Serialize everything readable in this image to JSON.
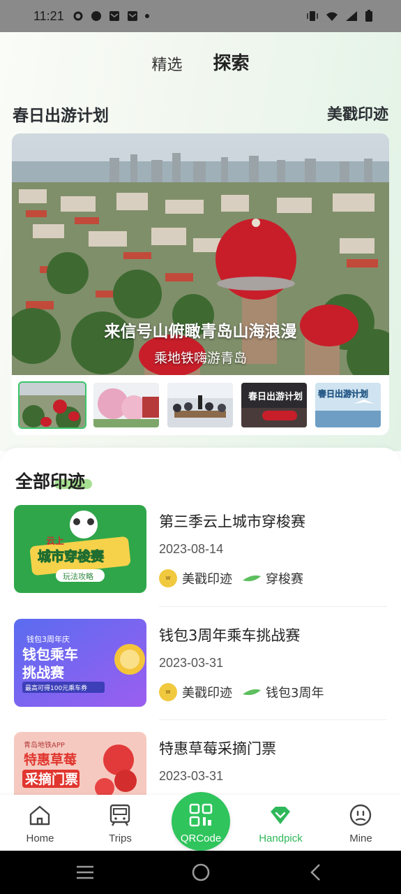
{
  "status_bar": {
    "time": "11:21"
  },
  "tabs": [
    {
      "label": "精选",
      "active": false
    },
    {
      "label": "探索",
      "active": true
    }
  ],
  "spring_section": {
    "title": "春日出游计划",
    "link": "美戳印迹"
  },
  "hero": {
    "title": "来信号山俯瞰青岛山海浪漫",
    "subtitle": "乘地铁嗨游青岛"
  },
  "thumbnails": [
    {
      "caption": "",
      "selected": true
    },
    {
      "caption": "",
      "selected": false
    },
    {
      "caption": "",
      "selected": false
    },
    {
      "caption": "春日出游计划",
      "selected": false
    },
    {
      "caption": "春日出游计划",
      "selected": false
    }
  ],
  "all_section": {
    "title": "全部印迹"
  },
  "items": [
    {
      "title": "第三季云上城市穿梭赛",
      "date": "2023-08-14",
      "tag1": "美戳印迹",
      "tag2": "穿梭赛",
      "image_text": [
        "云上",
        "城市穿梭赛",
        "玩法攻略"
      ]
    },
    {
      "title": "钱包3周年乘车挑战赛",
      "date": "2023-03-31",
      "tag1": "美戳印迹",
      "tag2": "钱包3周年",
      "image_text": [
        "钱包3周年庆",
        "钱包乘车",
        "挑战赛",
        "最高可得100元乘车券"
      ]
    },
    {
      "title": "特惠草莓采摘门票",
      "date": "2023-03-31",
      "image_text": [
        "青岛地铁APP",
        "特惠草莓",
        "采摘门票"
      ]
    }
  ],
  "tab_bar": [
    {
      "label": "Home",
      "icon": "home-icon",
      "active": false
    },
    {
      "label": "Trips",
      "icon": "train-icon",
      "active": false
    },
    {
      "label": "QRCode",
      "icon": "qrcode-icon",
      "active": false
    },
    {
      "label": "Handpick",
      "icon": "gem-icon",
      "active": true
    },
    {
      "label": "Mine",
      "icon": "face-icon",
      "active": false
    }
  ],
  "colors": {
    "accent": "#2fc45c",
    "highlight": "#8ad66d"
  }
}
